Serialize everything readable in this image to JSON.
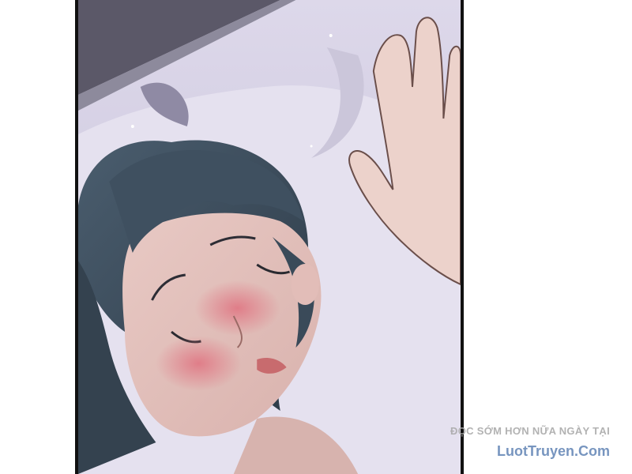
{
  "artwork": {
    "description_name": "comic-panel",
    "frame_color": "#111111",
    "background_color": "#ffffff"
  },
  "watermark": {
    "line1": "ĐỌC SỚM HƠN NỮA NGÀY TẠI",
    "line2": "LuotTruyen.Com"
  }
}
